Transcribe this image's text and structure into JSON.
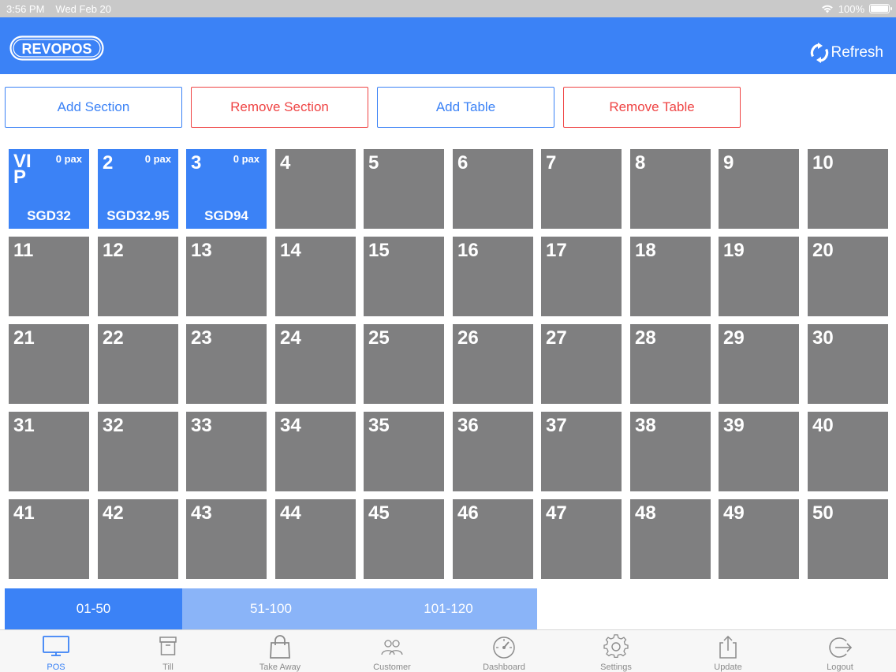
{
  "status_bar": {
    "time": "3:56 PM",
    "date": "Wed Feb 20",
    "battery": "100%"
  },
  "header": {
    "logo_text": "REVOPOS",
    "refresh_label": "Refresh",
    "bg_color": "#3b82f6"
  },
  "actions": {
    "add_section": "Add Section",
    "remove_section": "Remove Section",
    "add_table": "Add Table",
    "remove_table": "Remove Table"
  },
  "tables": [
    {
      "label": "VIP",
      "pax": "0 pax",
      "amount": "SGD32",
      "active": true
    },
    {
      "label": "2",
      "pax": "0 pax",
      "amount": "SGD32.95",
      "active": true
    },
    {
      "label": "3",
      "pax": "0 pax",
      "amount": "SGD94",
      "active": true
    },
    {
      "label": "4"
    },
    {
      "label": "5"
    },
    {
      "label": "6"
    },
    {
      "label": "7"
    },
    {
      "label": "8"
    },
    {
      "label": "9"
    },
    {
      "label": "10"
    },
    {
      "label": "11"
    },
    {
      "label": "12"
    },
    {
      "label": "13"
    },
    {
      "label": "14"
    },
    {
      "label": "15"
    },
    {
      "label": "16"
    },
    {
      "label": "17"
    },
    {
      "label": "18"
    },
    {
      "label": "19"
    },
    {
      "label": "20"
    },
    {
      "label": "21"
    },
    {
      "label": "22"
    },
    {
      "label": "23"
    },
    {
      "label": "24"
    },
    {
      "label": "25"
    },
    {
      "label": "26"
    },
    {
      "label": "27"
    },
    {
      "label": "28"
    },
    {
      "label": "29"
    },
    {
      "label": "30"
    },
    {
      "label": "31"
    },
    {
      "label": "32"
    },
    {
      "label": "33"
    },
    {
      "label": "34"
    },
    {
      "label": "35"
    },
    {
      "label": "36"
    },
    {
      "label": "37"
    },
    {
      "label": "38"
    },
    {
      "label": "39"
    },
    {
      "label": "40"
    },
    {
      "label": "41"
    },
    {
      "label": "42"
    },
    {
      "label": "43"
    },
    {
      "label": "44"
    },
    {
      "label": "45"
    },
    {
      "label": "46"
    },
    {
      "label": "47"
    },
    {
      "label": "48"
    },
    {
      "label": "49"
    },
    {
      "label": "50"
    }
  ],
  "page_tabs": [
    {
      "label": "01-50",
      "active": true
    },
    {
      "label": "51-100",
      "active": false
    },
    {
      "label": "101-120",
      "active": false
    }
  ],
  "nav": [
    {
      "label": "POS",
      "icon": "monitor-icon",
      "active": true
    },
    {
      "label": "Till",
      "icon": "box-icon",
      "active": false
    },
    {
      "label": "Take Away",
      "icon": "shopping-bag-icon",
      "active": false
    },
    {
      "label": "Customer",
      "icon": "users-icon",
      "active": false
    },
    {
      "label": "Dashboard",
      "icon": "gauge-icon",
      "active": false
    },
    {
      "label": "Settings",
      "icon": "gear-icon",
      "active": false
    },
    {
      "label": "Update",
      "icon": "share-icon",
      "active": false
    },
    {
      "label": "Logout",
      "icon": "logout-icon",
      "active": false
    }
  ],
  "colors": {
    "accent": "#3b82f6",
    "tab_inactive": "#8ab4f8",
    "table_idle": "#7f7f80",
    "danger": "#ef4444"
  }
}
